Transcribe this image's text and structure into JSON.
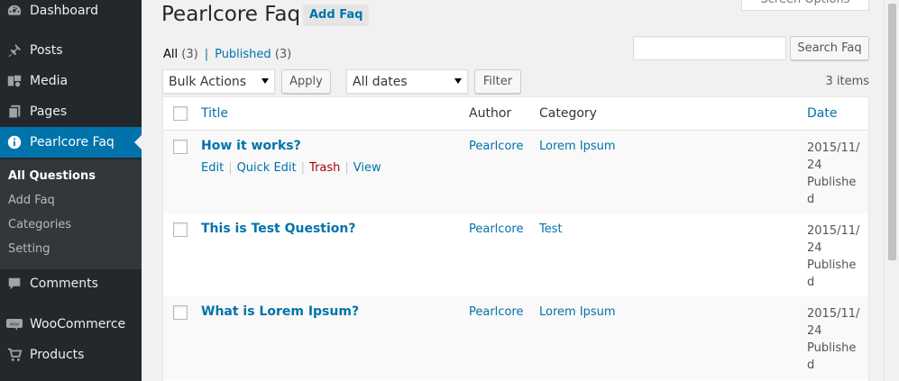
{
  "sidebar": {
    "items": [
      {
        "label": "Dashboard",
        "icon": "dashboard-icon"
      },
      {
        "label": "Posts",
        "icon": "pin-icon"
      },
      {
        "label": "Media",
        "icon": "media-icon"
      },
      {
        "label": "Pages",
        "icon": "pages-icon"
      },
      {
        "label": "Pearlcore Faq",
        "icon": "info-icon"
      },
      {
        "label": "Comments",
        "icon": "comment-icon"
      },
      {
        "label": "WooCommerce",
        "icon": "woocommerce-icon"
      },
      {
        "label": "Products",
        "icon": "cart-icon"
      }
    ],
    "submenu": [
      "All Questions",
      "Add Faq",
      "Categories",
      "Setting"
    ],
    "current_sub": "All Questions"
  },
  "header": {
    "title": "Pearlcore Faq",
    "add_button": "Add Faq",
    "screen_options": "Screen Options"
  },
  "filters": {
    "all_label": "All",
    "all_count": "(3)",
    "published_label": "Published",
    "published_count": "(3)",
    "separator": "|",
    "search_value": "",
    "search_button": "Search Faq",
    "bulk_actions": "Bulk Actions",
    "apply_button": "Apply",
    "all_dates": "All dates",
    "filter_button": "Filter",
    "items_count": "3 items"
  },
  "table": {
    "columns": [
      "Title",
      "Author",
      "Category",
      "Date"
    ],
    "row_actions": {
      "edit": "Edit",
      "quick_edit": "Quick Edit",
      "trash": "Trash",
      "view": "View"
    },
    "rows": [
      {
        "title": "How it works?",
        "author": "Pearlcore",
        "category": "Lorem Ipsum",
        "date": "2015/11/24",
        "status": "Published"
      },
      {
        "title": "This is Test Question?",
        "author": "Pearlcore",
        "category": "Test",
        "date": "2015/11/24",
        "status": "Published"
      },
      {
        "title": "What is Lorem Ipsum?",
        "author": "Pearlcore",
        "category": "Lorem Ipsum",
        "date": "2015/11/24",
        "status": "Published"
      }
    ]
  },
  "colors": {
    "sidebar_bg": "#23282d",
    "submenu_bg": "#32373c",
    "accent": "#0073aa",
    "trash": "#aa0000"
  }
}
